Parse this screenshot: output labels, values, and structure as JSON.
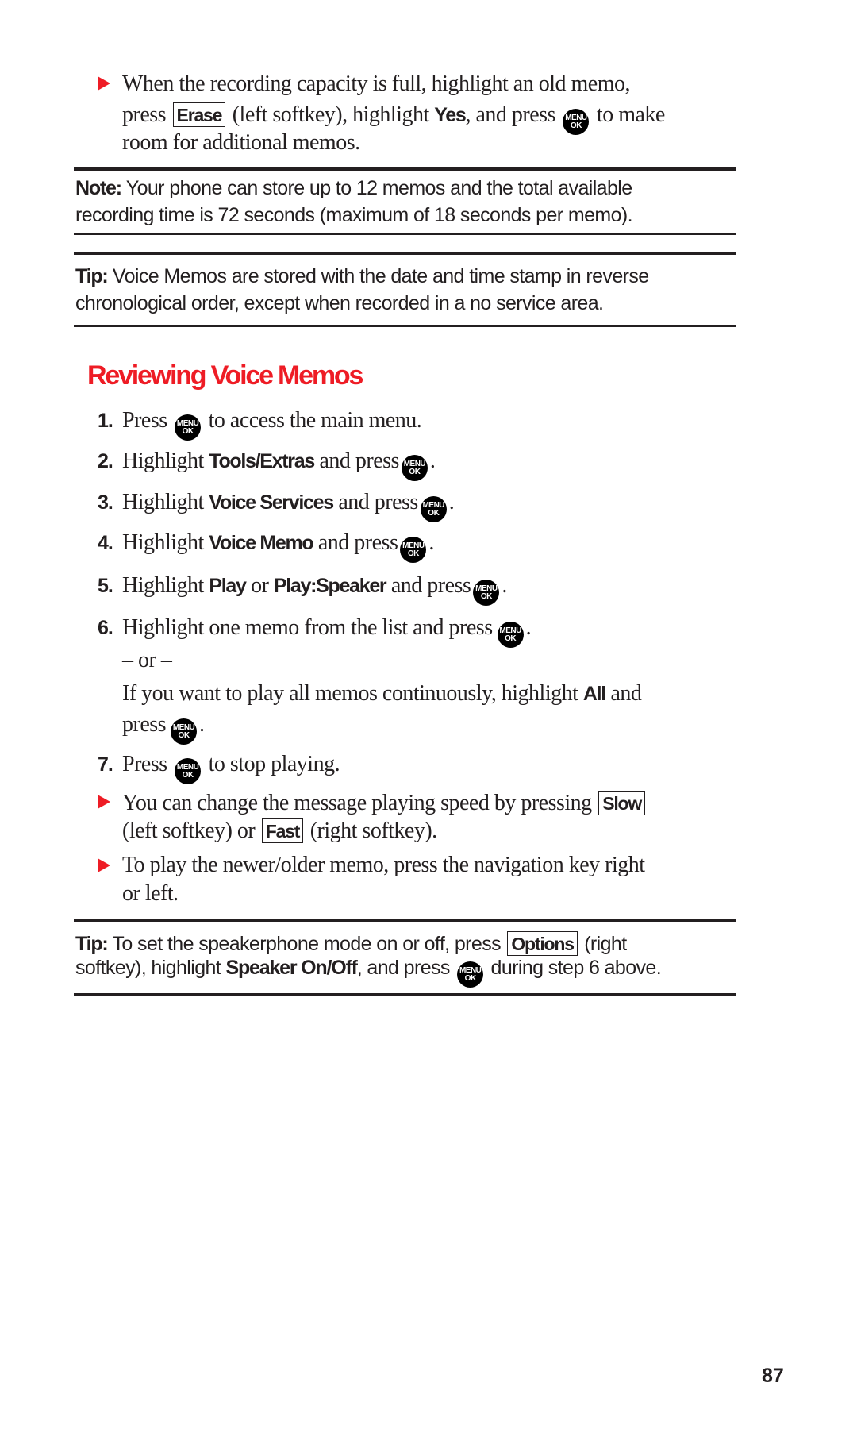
{
  "intro_bullet": {
    "line1": "When the recording capacity is full, highlight an old memo,",
    "line2_pre": "press",
    "softkey_erase": "Erase",
    "line2_mid": "(left softkey), highlight",
    "yes": "Yes",
    "line2_post": ", and press",
    "line2_end": "to make",
    "line3": "room for additional memos."
  },
  "menu_ok_icon": {
    "top": "MENU",
    "bottom": "OK"
  },
  "note": {
    "label": "Note:",
    "line1": "Your phone can store up to 12 memos and the total available",
    "line2": "recording time is 72 seconds (maximum of 18 seconds per memo)."
  },
  "tip1": {
    "label": "Tip:",
    "line1": "Voice Memos are stored with the date and time stamp in reverse",
    "line2": "chronological order, except when recorded in a no service area."
  },
  "section_heading": "Reviewing Voice Memos",
  "steps": [
    {
      "num": "1.",
      "pre": "Press",
      "post": "to access the main menu."
    },
    {
      "num": "2.",
      "pre": "Highlight",
      "bold": "Tools/Extras",
      "post": "and press",
      "end": "."
    },
    {
      "num": "3.",
      "pre": "Highlight",
      "bold": "Voice Services",
      "post": "and press",
      "end": "."
    },
    {
      "num": "4.",
      "pre": "Highlight",
      "bold": "Voice Memo",
      "post": "and press",
      "end": "."
    },
    {
      "num": "5.",
      "pre": "Highlight",
      "bold": "Play",
      "mid": "or",
      "bold2": "Play:Speaker",
      "post": "and press",
      "end": "."
    },
    {
      "num": "6.",
      "pre": "Highlight one memo from the list and press",
      "end": ".",
      "or": "– or –",
      "alt_line1_pre": "If you want to play all memos continuously, highlight",
      "alt_bold": "All",
      "alt_line1_post": "and",
      "alt_line2_pre": "press",
      "alt_line2_end": "."
    },
    {
      "num": "7.",
      "pre": "Press",
      "post": "to stop playing."
    }
  ],
  "bullets": [
    {
      "line1_pre": "You can change the message playing speed by pressing",
      "key1": "Slow",
      "line2_pre": "(left softkey) or",
      "key2": "Fast",
      "line2_post": "(right softkey)."
    },
    {
      "line1": "To play the newer/older memo, press the navigation key right",
      "line2": "or left."
    }
  ],
  "tip2": {
    "label": "Tip:",
    "line1_pre": "To set the speakerphone mode on or off, press",
    "key": "Options",
    "line1_post": "(right",
    "line2_pre": "softkey), highlight",
    "bold": "Speaker On/Off",
    "line2_mid": ", and press",
    "line2_post": "during step 6 above."
  },
  "page_number": "87",
  "colors": {
    "accent": "#ee1c25",
    "text": "#231f20"
  }
}
